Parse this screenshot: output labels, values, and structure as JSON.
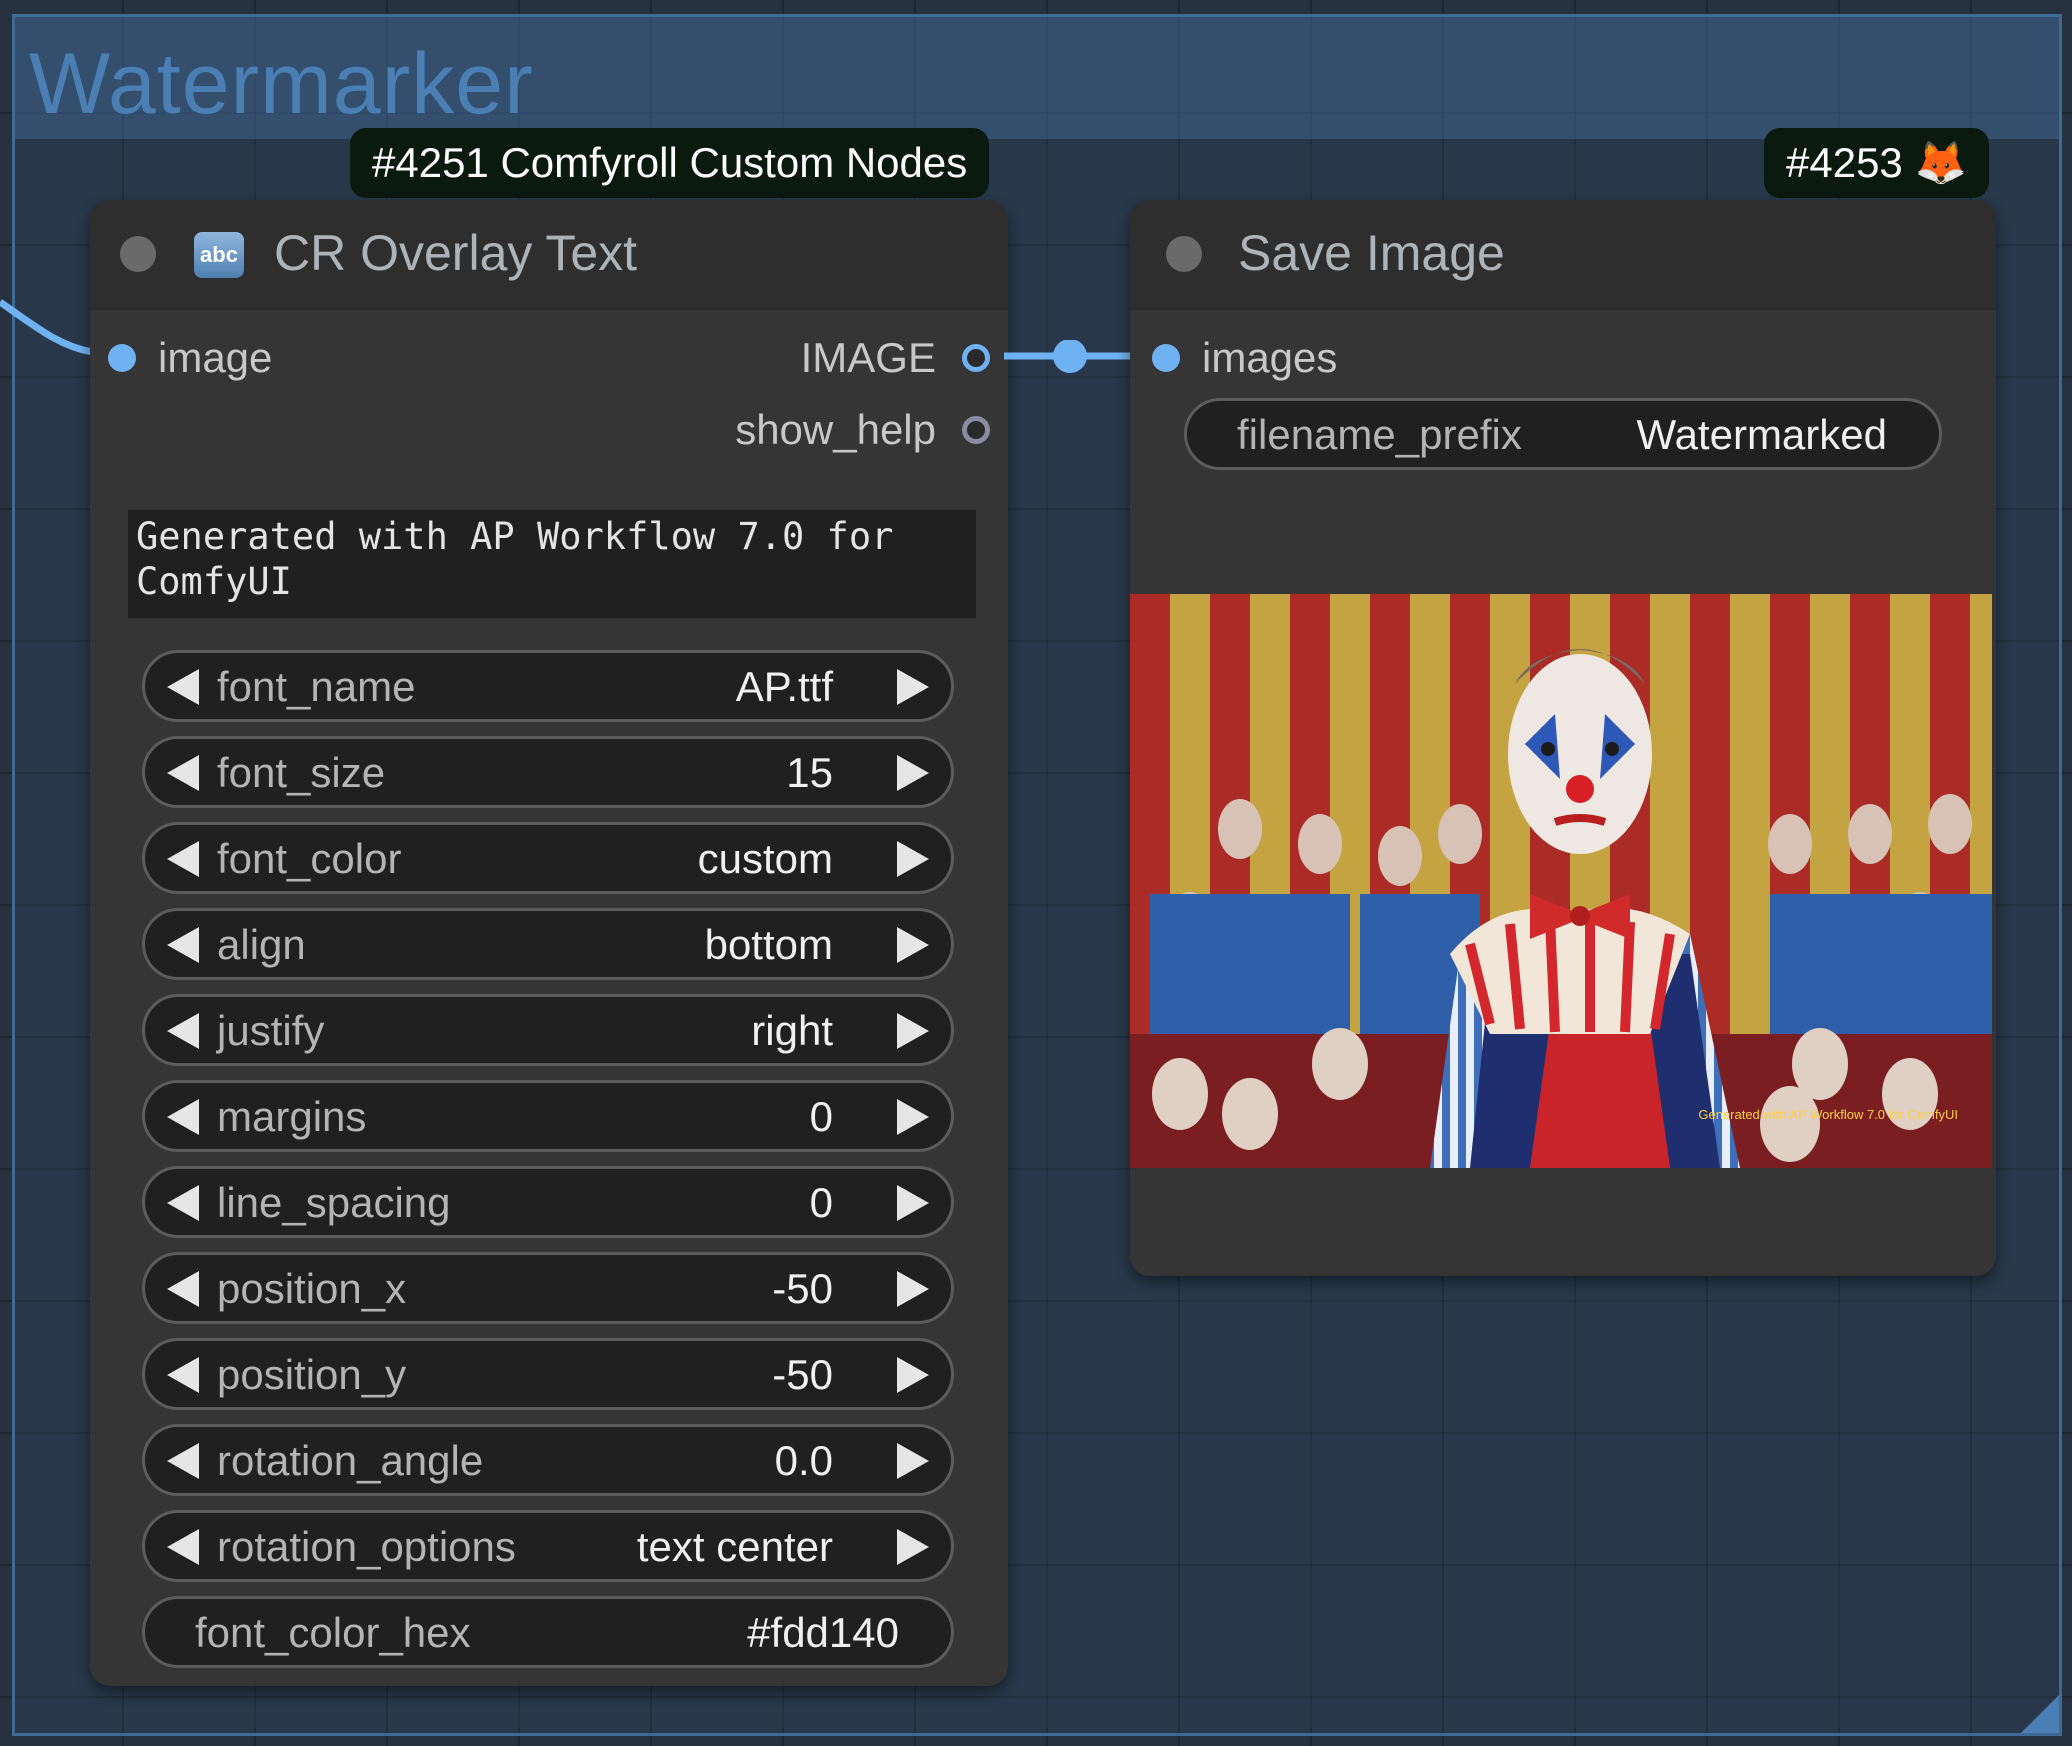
{
  "group": {
    "title": "Watermarker"
  },
  "badges": {
    "overlay": "#4251 Comfyroll Custom Nodes",
    "save": "#4253 🦊"
  },
  "overlay_node": {
    "icon_text": "abc",
    "title": "CR Overlay Text",
    "inputs": [
      {
        "label": "image"
      }
    ],
    "outputs": [
      {
        "label": "IMAGE"
      },
      {
        "label": "show_help"
      }
    ],
    "text": "Generated with AP Workflow 7.0 for\nComfyUI",
    "widgets": [
      {
        "name": "font_name",
        "value": "AP.ttf"
      },
      {
        "name": "font_size",
        "value": "15"
      },
      {
        "name": "font_color",
        "value": "custom"
      },
      {
        "name": "align",
        "value": "bottom"
      },
      {
        "name": "justify",
        "value": "right"
      },
      {
        "name": "margins",
        "value": "0"
      },
      {
        "name": "line_spacing",
        "value": "0"
      },
      {
        "name": "position_x",
        "value": "-50"
      },
      {
        "name": "position_y",
        "value": "-50"
      },
      {
        "name": "rotation_angle",
        "value": "0.0"
      },
      {
        "name": "rotation_options",
        "value": "text center"
      }
    ],
    "text_widget": {
      "name": "font_color_hex",
      "value": "#fdd140"
    }
  },
  "save_node": {
    "title": "Save Image",
    "inputs": [
      {
        "label": "images"
      }
    ],
    "filename_prefix": {
      "name": "filename_prefix",
      "value": "Watermarked"
    },
    "preview_watermark": "Generated with AP Workflow 7.0 for ComfyUI"
  },
  "colors": {
    "link_image": "#6fb2f2",
    "group_accent": "#4b7fb3",
    "watermark": "#fdd140"
  }
}
